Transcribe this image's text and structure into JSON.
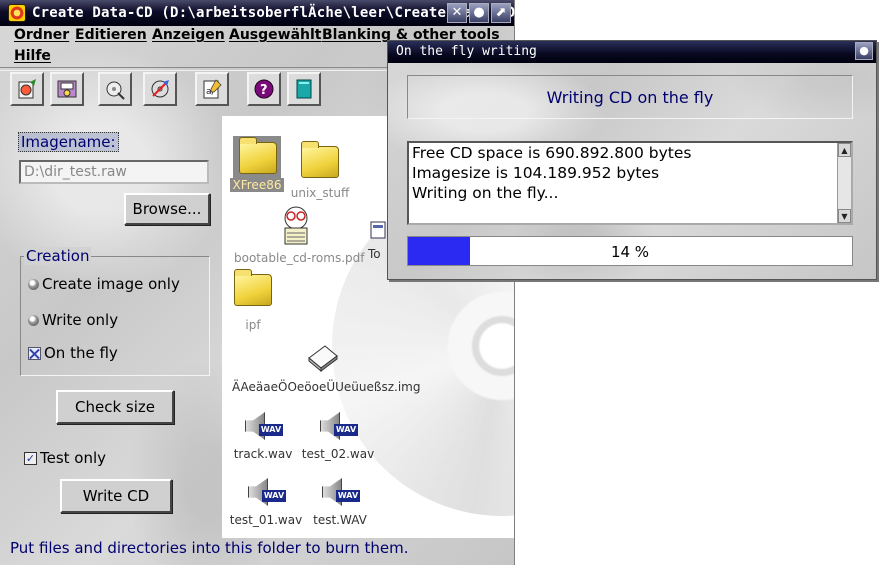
{
  "main_window": {
    "title": "Create Data-CD (D:\\arbeitsoberflÄche\\leer\\Create Data-CD)",
    "menu": [
      "Ordner",
      "Editieren",
      "Anzeigen",
      "Ausgewählt",
      "Blanking & other tools",
      "Hilfe"
    ],
    "image_label": "Imagename:",
    "image_value": "D:\\dir_test.raw",
    "browse_label": "Browse...",
    "creation": {
      "title": "Creation",
      "options": [
        "Create image only",
        "Write only",
        "On the fly"
      ],
      "selected": "On the fly"
    },
    "check_size_label": "Check size",
    "test_only_label": "Test only",
    "write_cd_label": "Write CD",
    "status": "Put files and directories into this folder to burn them.",
    "files": [
      {
        "name": "XFree86",
        "type": "folder",
        "selected": true
      },
      {
        "name": "unix_stuff",
        "type": "folder"
      },
      {
        "name": "bootable_cd-roms.pdf",
        "type": "pdf"
      },
      {
        "name": "To",
        "type": "doc"
      },
      {
        "name": "ipf",
        "type": "folder"
      },
      {
        "name": "ÄAeäaeÖOeöoeÜUeüueßsz.img",
        "type": "img"
      },
      {
        "name": "track.wav",
        "type": "wav"
      },
      {
        "name": "test_02.wav",
        "type": "wav"
      },
      {
        "name": "test_01.wav",
        "type": "wav"
      },
      {
        "name": "test.WAV",
        "type": "wav"
      }
    ],
    "wav_tag": "WAV"
  },
  "dialog": {
    "title": "On the fly writing",
    "heading": "Writing CD on the fly",
    "log": [
      "Free CD space is 690.892.800 bytes",
      "Imagesize is 104.189.952 bytes",
      "Writing on the fly..."
    ],
    "progress_percent": 14,
    "progress_text": "14 %"
  },
  "colors": {
    "accent_blue": "#00006e",
    "progress_fill": "#2a2af2"
  }
}
